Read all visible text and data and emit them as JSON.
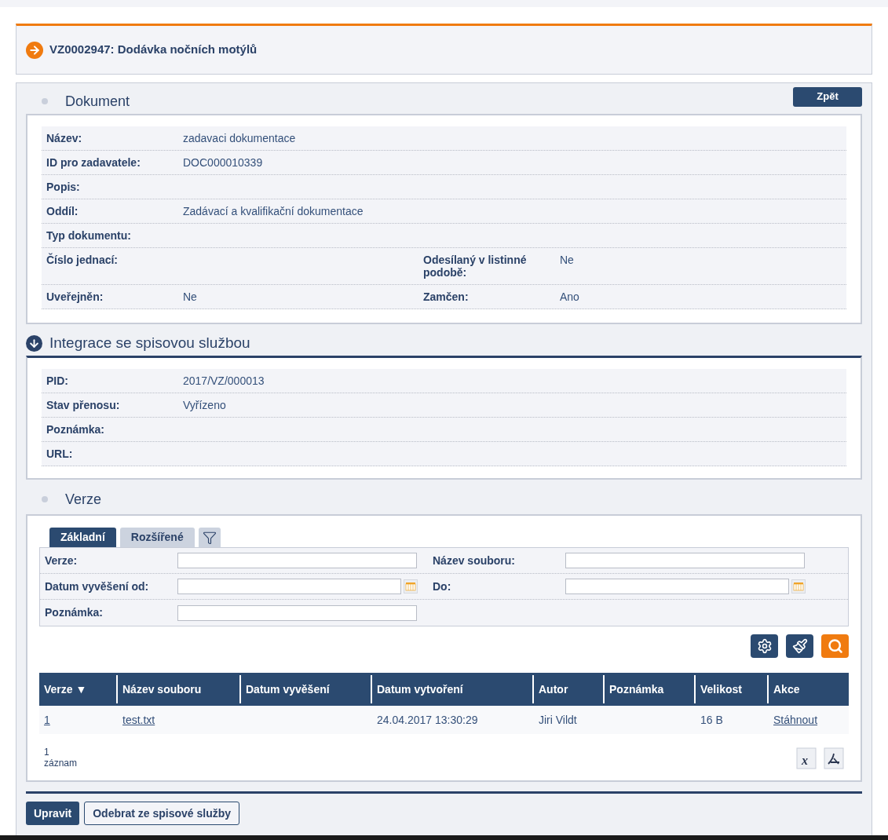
{
  "header": {
    "title": "VZ0002947: Dodávka nočních motýlů"
  },
  "document": {
    "title": "Dokument",
    "back_button": "Zpět",
    "rows": [
      [
        {
          "label": "Název:",
          "value": "zadavaci dokumentace"
        }
      ],
      [
        {
          "label": "ID pro zadavatele:",
          "value": "DOC000010339"
        }
      ],
      [
        {
          "label": "Popis:"
        }
      ],
      [
        {
          "label": "Oddíl:",
          "value": "Zadávací a kvalifikační dokumentace"
        }
      ],
      [
        {
          "label": "Typ dokumentu:"
        }
      ],
      [
        {
          "label": "Číslo jednací:"
        },
        {
          "label": "Odesílaný v listinné podobě:",
          "value": "Ne"
        }
      ],
      [
        {
          "label": "Uveřejněn:",
          "value": "Ne"
        },
        {
          "label": "Zamčen:",
          "value": "Ano"
        }
      ]
    ]
  },
  "integration": {
    "title": "Integrace se spisovou službou",
    "rows": [
      [
        {
          "label": "PID:",
          "value": "2017/VZ/000013"
        }
      ],
      [
        {
          "label": "Stav přenosu:",
          "value": "Vyřízeno"
        }
      ],
      [
        {
          "label": "Poznámka:"
        }
      ],
      [
        {
          "label": "URL:"
        }
      ]
    ]
  },
  "versions": {
    "title": "Verze",
    "tabs": [
      {
        "label": "Základní",
        "selected": true
      },
      {
        "label": "Rozšířené",
        "selected": false
      }
    ],
    "filter_rows": [
      [
        {
          "label": "Verze:",
          "kind": "text"
        },
        {
          "label": "Název souboru:",
          "kind": "text"
        }
      ],
      [
        {
          "label": "Datum vyvěšení od:",
          "kind": "date"
        },
        {
          "label": "Do:",
          "kind": "date"
        }
      ],
      [
        {
          "label": "Poznámka:",
          "kind": "text"
        }
      ]
    ],
    "table": {
      "columns": [
        "Verze ▼",
        "Název souboru",
        "Datum vyvěšení",
        "Datum vytvoření",
        "Autor",
        "Poznámka",
        "Velikost",
        "Akce"
      ],
      "rows": [
        [
          {
            "text": "1",
            "kind": "link"
          },
          {
            "text": "test.txt",
            "kind": "link"
          },
          {
            "kind": "empty"
          },
          {
            "text": "24.04.2017 13:30:29",
            "kind": "text"
          },
          {
            "text": "Jiri Vildt",
            "kind": "text"
          },
          {
            "kind": "empty"
          },
          {
            "text": "16 B",
            "kind": "text"
          },
          {
            "text": "Stáhnout",
            "kind": "link"
          }
        ]
      ]
    },
    "count": "1 záznam",
    "excel_export_glyph": "x"
  },
  "footer_buttons": [
    {
      "label": "Upravit",
      "kind": "primary"
    },
    {
      "label": "Odebrat ze spisové služby",
      "kind": "secondary"
    }
  ]
}
